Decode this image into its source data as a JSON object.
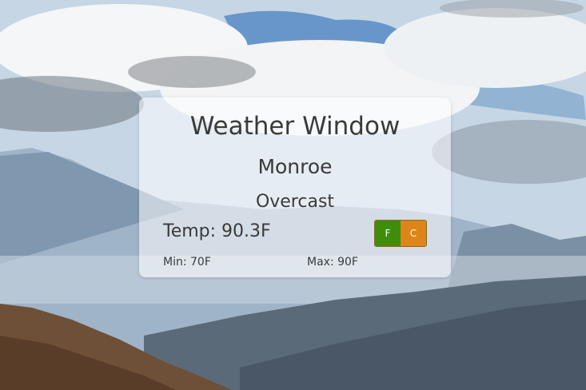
{
  "app": {
    "title": "Weather Window"
  },
  "weather": {
    "city": "Monroe",
    "condition": "Overcast",
    "temp_text": "Temp: 90.3F",
    "min_text": "Min: 70F",
    "max_text": "Max: 90F"
  },
  "units": {
    "fahrenheit_label": "F",
    "celsius_label": "C",
    "fahrenheit_color": "#3e8e0c",
    "celsius_color": "#de8418"
  }
}
